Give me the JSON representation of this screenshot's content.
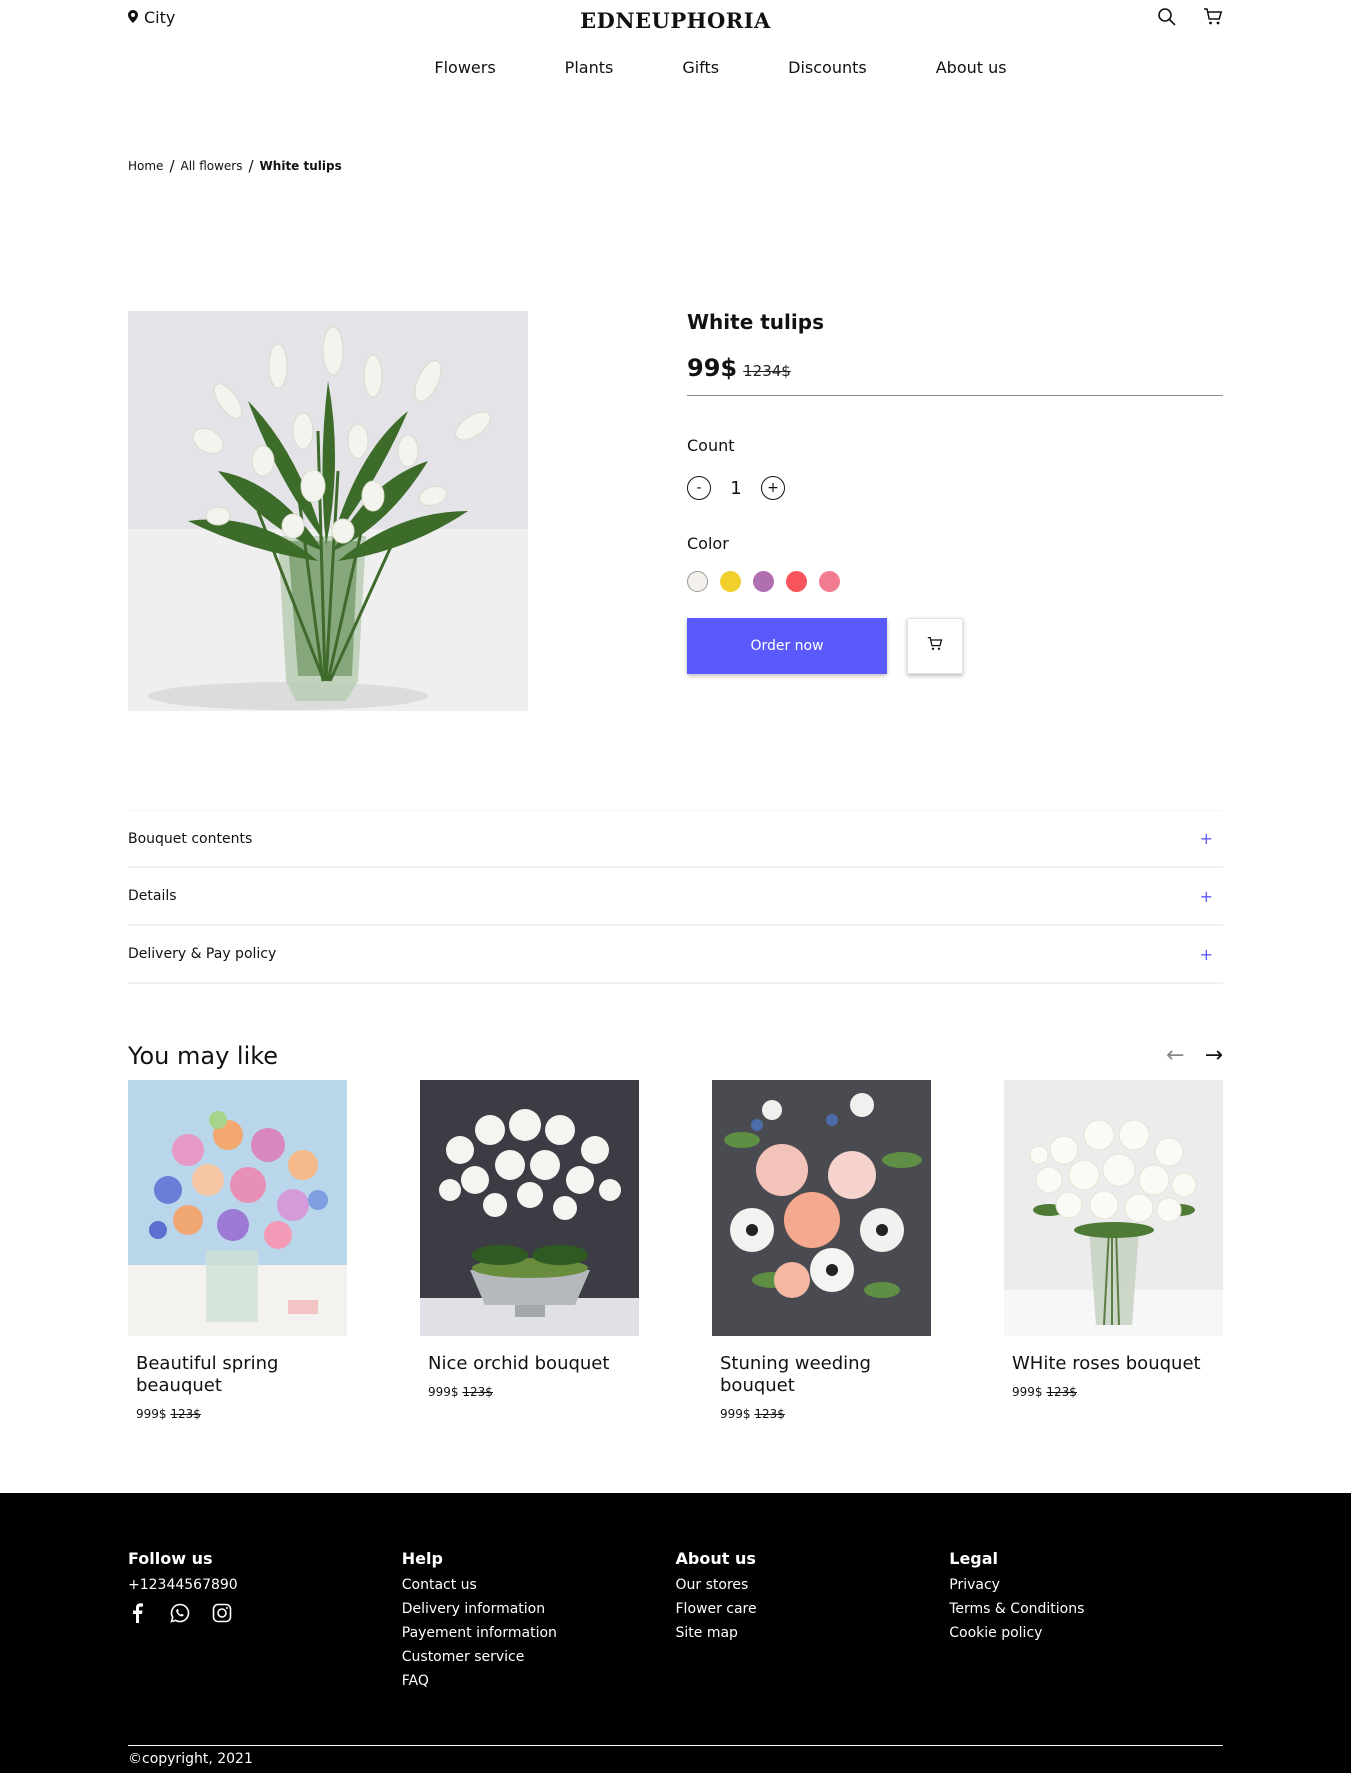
{
  "header": {
    "city": "City",
    "logo": "EDNEUPHORIA",
    "icons": [
      "location-pin-icon",
      "search-icon",
      "cart-icon"
    ]
  },
  "nav": {
    "items": [
      "Flowers",
      "Plants",
      "Gifts",
      "Discounts",
      "About us"
    ]
  },
  "breadcrumb": {
    "home": "Home",
    "category": "All flowers",
    "current": "White tulips",
    "separator": "/"
  },
  "product": {
    "title": "White tulips",
    "price": "99$",
    "old_price": "1234$",
    "count_label": "Count",
    "minus": "-",
    "plus": "+",
    "quantity": "1",
    "color_label": "Color",
    "colors": [
      "#f4f1ec",
      "#f2d02c",
      "#b06fb0",
      "#f7545b",
      "#f37b8f"
    ],
    "order_label": "Order now"
  },
  "accordion": {
    "items": [
      "Bouquet contents",
      "Details",
      "Delivery & Pay policy"
    ],
    "expand_symbol": "+"
  },
  "recommendations": {
    "title": "You may like",
    "prev": "←",
    "next": "→",
    "items": [
      {
        "name": "Beautiful spring beauquet",
        "price": "999$",
        "old_price": "123$"
      },
      {
        "name": "Nice orchid bouquet",
        "price": "999$",
        "old_price": "123$"
      },
      {
        "name": "Stuning weeding bouquet",
        "price": "999$",
        "old_price": "123$"
      },
      {
        "name": "WHite roses bouquet",
        "price": "999$",
        "old_price": "123$"
      }
    ]
  },
  "footer": {
    "follow": {
      "title": "Follow us",
      "phone": "+12344567890",
      "icons": [
        "facebook-icon",
        "whatsapp-icon",
        "instagram-icon"
      ]
    },
    "help": {
      "title": "Help",
      "links": [
        "Contact us",
        "Delivery information",
        "Payement information",
        "Customer service",
        "FAQ"
      ]
    },
    "about": {
      "title": "About us",
      "links": [
        "Our stores",
        "Flower care",
        "Site map"
      ]
    },
    "legal": {
      "title": "Legal",
      "links": [
        "Privacy",
        "Terms & Conditions",
        "Cookie policy"
      ]
    },
    "copyright": "©copyright, 2021"
  }
}
